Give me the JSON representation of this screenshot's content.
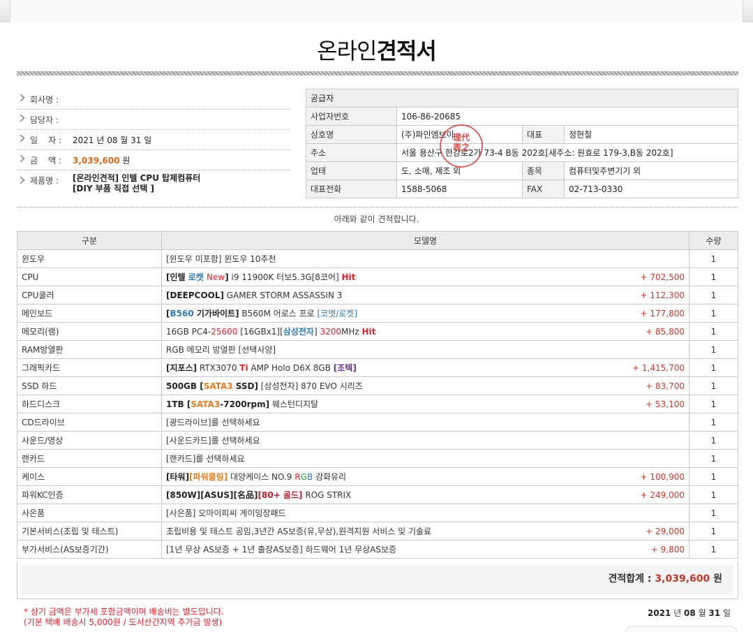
{
  "title": {
    "normal": "온라인",
    "bold": "견적서"
  },
  "customer": {
    "company_label": "회사명 :",
    "company_value": "",
    "manager_label": "담당자 :",
    "manager_value": "",
    "date_label": "일    자 :",
    "date_value": "2021 년 08 월 31 일",
    "amount_label": "금    액 :",
    "amount_value": "3,039,600",
    "amount_unit": "원",
    "product_label": "제품명 :",
    "product_line1": "[온라인견적] 인텔 CPU 탑제컴퓨터",
    "product_line2": "[DIY 부품 직접 선택 ]"
  },
  "supplier": {
    "header": "공급자",
    "bizno_label": "사업자번호",
    "bizno_value": "106-86-20685",
    "name_label": "상호명",
    "name_value": "(주)파인엠브이",
    "ceo_label": "대표",
    "ceo_value": "정현철",
    "addr_label": "주소",
    "addr_value": "서울 용산구 한강로2가 73-4 B동 202호[새주소: 원효로 179-3,B동 202호]",
    "type_label": "업태",
    "type_value": "도, 소매, 제조 외",
    "item_label": "종목",
    "item_value": "컴퓨터및주변기기 외",
    "tel_label": "대표전화",
    "tel_value": "1588-5068",
    "fax_label": "FAX",
    "fax_value": "02-713-0330",
    "stamp_line1": "理代",
    "stamp_line2": "表之"
  },
  "intro": "아래와 같이 견적합니다.",
  "table": {
    "col_category": "구분",
    "col_model": "모델명",
    "col_qty": "수량",
    "rows": [
      {
        "category": "윈도우",
        "model": "[윈도우 미포함] 윈도우 10추천",
        "price": "",
        "qty": "1"
      },
      {
        "category": "CPU",
        "model": "[인텔 로켓 New] i9 11900K 터보5.3G[8코어] Hit",
        "price": "+ 702,500",
        "qty": "1"
      },
      {
        "category": "CPU쿨러",
        "model": "[DEEPCOOL] GAMER STORM ASSASSIN 3",
        "price": "+ 112,300",
        "qty": "1"
      },
      {
        "category": "메인보드",
        "model": "[B560 기가바이트] B560M 어로스 프로 [코멧/로켓]",
        "price": "+ 177,800",
        "qty": "1"
      },
      {
        "category": "메모리(램)",
        "model": "16GB PC4-25600 [16GBx1][삼성전자] 3200MHz Hit",
        "price": "+ 85,800",
        "qty": "1"
      },
      {
        "category": "RAM방열판",
        "model": "RGB 메모리 방열판 [선택사양]",
        "price": "",
        "qty": "1"
      },
      {
        "category": "그래픽카드",
        "model": "[지포스] RTX3070 Ti AMP Holo D6X 8GB [조텍]",
        "price": "+ 1,415,700",
        "qty": "1"
      },
      {
        "category": "SSD 하드",
        "model": "500GB [SATA3 SSD] [삼성전자] 870 EVO 시리즈",
        "price": "+ 83,700",
        "qty": "1"
      },
      {
        "category": "하드디스크",
        "model": "1TB [SATA3-7200rpm] 웨스턴디지탈",
        "price": "+ 53,100",
        "qty": "1"
      },
      {
        "category": "CD드라이브",
        "model": "[광드라이브]를 선택하세요",
        "price": "",
        "qty": "1"
      },
      {
        "category": "사운드/영상",
        "model": "[사운드카드]를 선택하세요",
        "price": "",
        "qty": "1"
      },
      {
        "category": "랜카드",
        "model": "[랜카드]를 선택하세요",
        "price": "",
        "qty": "1"
      },
      {
        "category": "케이스",
        "model": "[타워][파워쿨링] 대양케이스 NO.9 RGB 강화유리",
        "price": "+ 100,900",
        "qty": "1"
      },
      {
        "category": "파워KC인증",
        "model": "[850W][ASUS][名品][80+ 골드] ROG STRIX",
        "price": "+ 249,000",
        "qty": "1"
      },
      {
        "category": "사은품",
        "model": "[사은품] 오마이피씨 게이밍장패드",
        "price": "",
        "qty": "1"
      },
      {
        "category": "기본서비스(조립 및 테스트)",
        "model": "조립비용 및 테스트 공임,3년간 AS보증(유,무상),원격지원 서비스 및 기술료",
        "price": "+ 29,000",
        "qty": "1"
      },
      {
        "category": "부가서비스(AS보증기간)",
        "model": "[1년 무상 AS보증 + 1년 출장AS보증] 하드웨어 1년 무상AS보증",
        "price": "+ 9,800",
        "qty": "1"
      }
    ]
  },
  "total": {
    "label": "견적합계 :",
    "amount": "3,039,600",
    "unit": "원"
  },
  "notes": {
    "line1": "* 상기 금액은 부가세 포함금액이며 배송비는 별도입니다.",
    "line2": "(기본 택배 배송시 5,000원 / 도서산간지역 추가금 발생)"
  },
  "footer_date": {
    "year": "2021",
    "year_unit": "년",
    "month": "08",
    "month_unit": "월",
    "day": "31",
    "day_unit": "일"
  }
}
